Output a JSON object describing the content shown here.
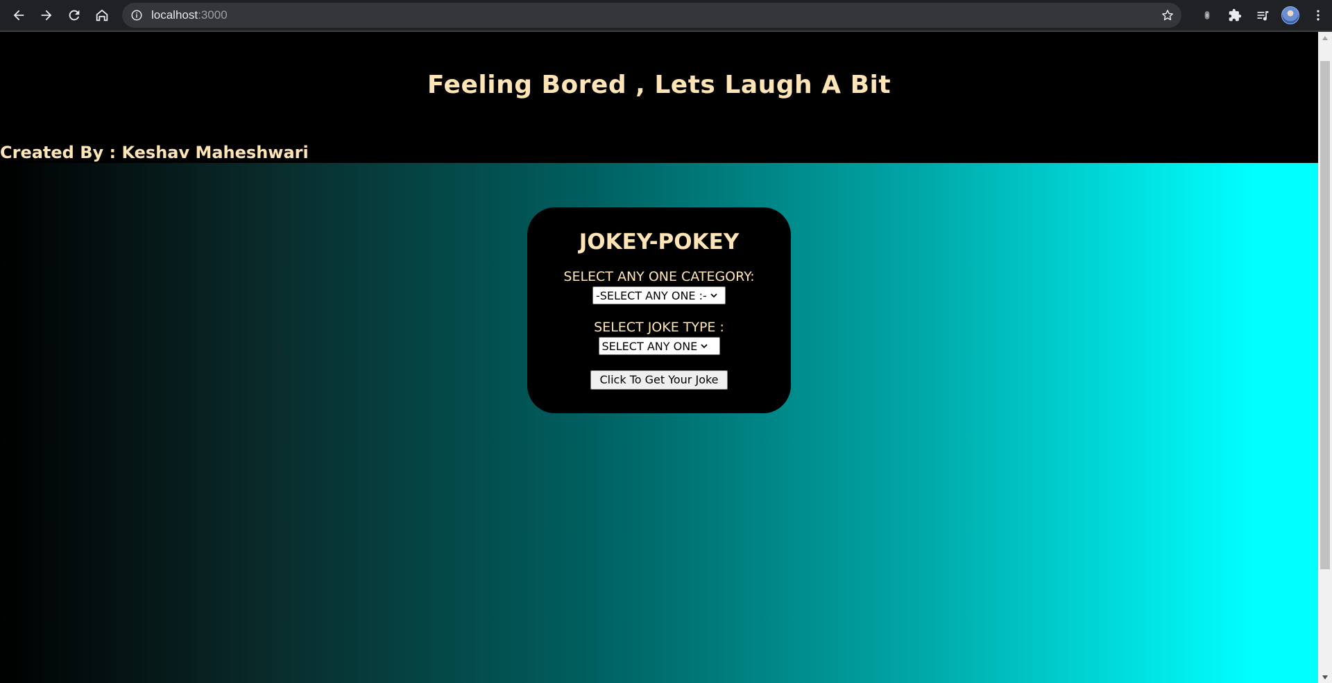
{
  "browser": {
    "url_host": "localhost",
    "url_port": ":3000",
    "icons": [
      "back-icon",
      "forward-icon",
      "reload-icon",
      "home-icon",
      "site-info-icon",
      "bookmark-star-icon",
      "extension-icon",
      "puzzle-icon",
      "reading-list-icon",
      "profile-avatar",
      "menu-kebab-icon"
    ]
  },
  "header": {
    "title": "Feeling Bored , Lets Laugh A Bit",
    "credit": "Created By : Keshav Maheshwari"
  },
  "card": {
    "title": "JOKEY-POKEY",
    "category_label": "SELECT ANY ONE CATEGORY:",
    "category_selected": "-SELECT ANY ONE :-",
    "type_label": "SELECT JOKE TYPE :",
    "type_selected": "SELECT ANY ONE",
    "button_label": "Click To Get Your Joke"
  },
  "colors": {
    "text_accent": "#ffe4b5",
    "gradient_start": "#000000",
    "gradient_end": "#00ffff"
  }
}
